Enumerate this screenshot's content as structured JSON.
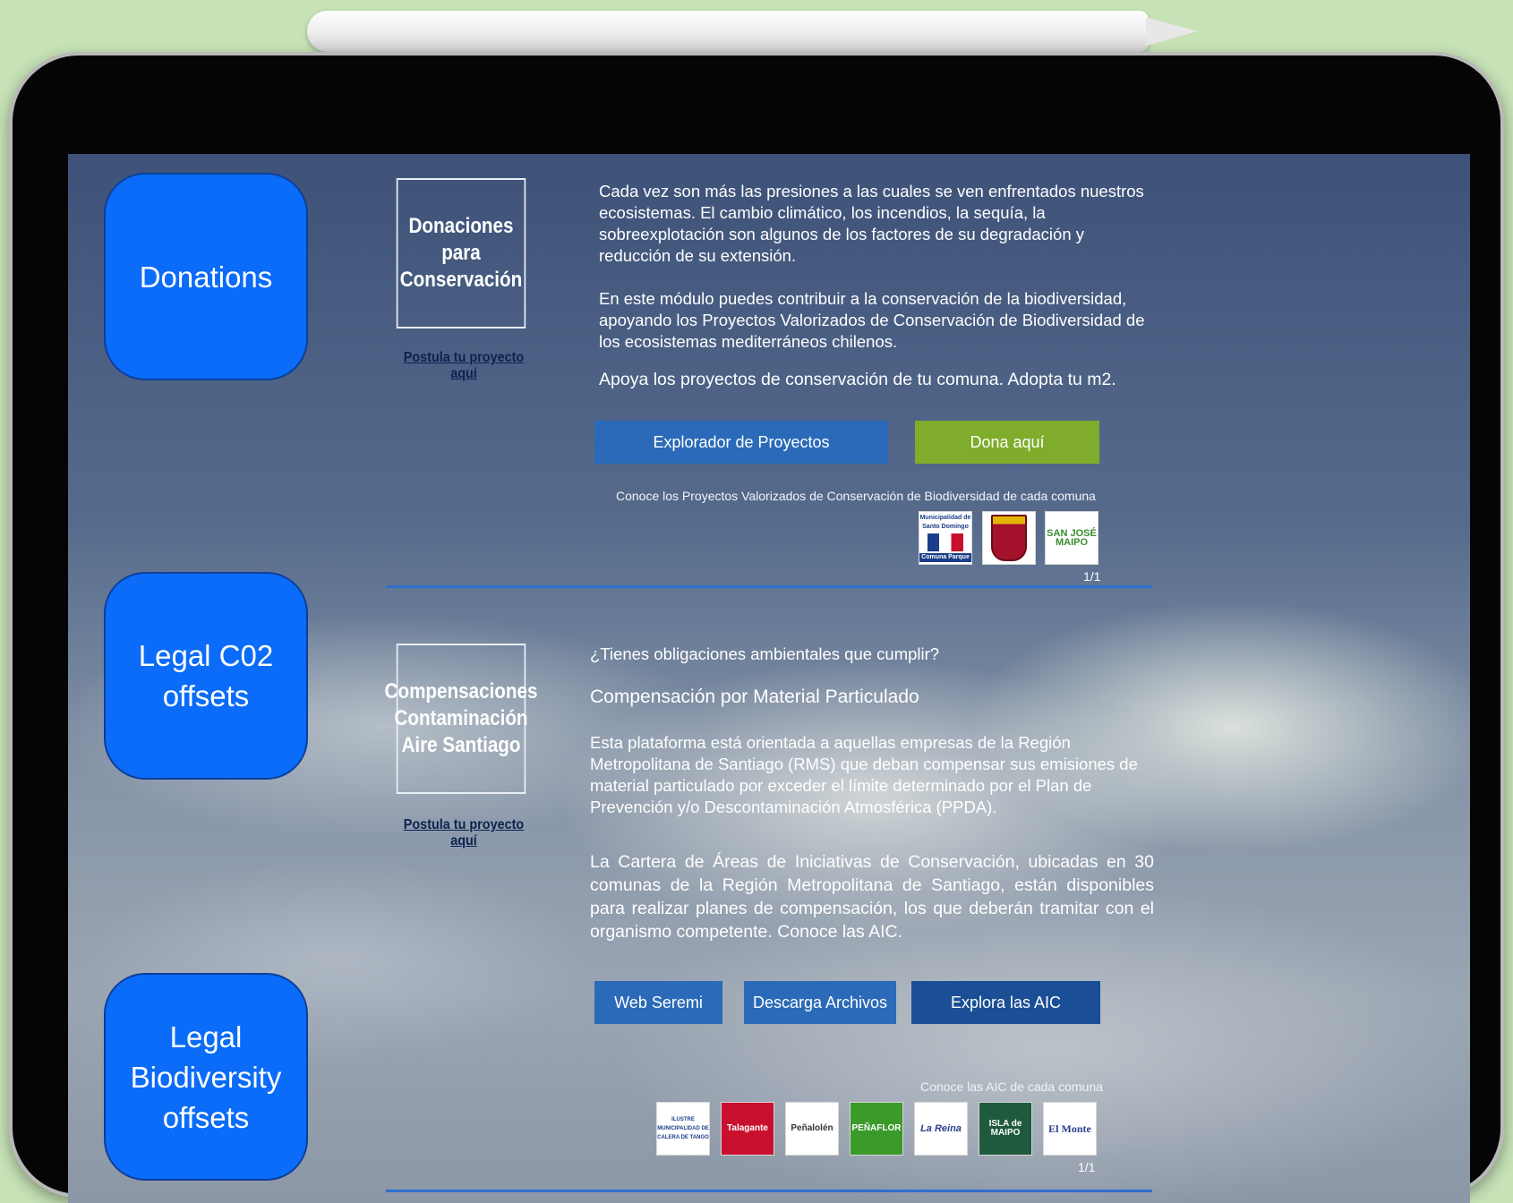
{
  "nav": {
    "donations": "Donations",
    "legal_co2": "Legal C02 offsets",
    "legal_biodiversity": "Legal Biodiversity offsets"
  },
  "section1": {
    "logo_text": "Donaciones para Conservación",
    "postula_link": "Postula tu proyecto aquí",
    "paragraph1": "Cada vez son más las presiones a las cuales se ven enfrentados nuestros ecosistemas. El cambio climático, los incendios, la sequía, la sobreexplotación son algunos de los factores de su degradación y reducción de su extensión.",
    "paragraph2": "En este módulo puedes contribuir a la conservación de la biodiversidad, apoyando los Proyectos Valorizados de Conservación de Biodiversidad de los ecosistemas mediterráneos chilenos.",
    "paragraph3": "Apoya los proyectos de conservación de tu comuna. Adopta tu m2.",
    "button_explorer": "Explorador de Proyectos",
    "button_donate": "Dona aquí",
    "caption": "Conoce los Proyectos Valorizados de Conservación de Biodiversidad de cada comuna",
    "logos": [
      {
        "top": "Municipalidad de Santo Domingo",
        "bottom": "Comuna Parque"
      },
      {
        "text": ""
      },
      {
        "text": "SAN JOSÉ MAIPO"
      }
    ],
    "pager": "1/1"
  },
  "section2": {
    "logo_text": "Compensaciones Contaminación Aire Santiago",
    "postula_link": "Postula tu proyecto aquí",
    "question": "¿Tienes obligaciones ambientales que cumplir?",
    "heading": "Compensación por Material Particulado",
    "paragraph1": "Esta plataforma está orientada a aquellas empresas de la Región Metropolitana de Santiago (RMS) que deban compensar sus emisiones de material particulado por exceder el límite determinado por el Plan de Prevención y/o Descontaminación Atmosférica (PPDA).",
    "paragraph2": "La Cartera de Áreas de Iniciativas de Conservación, ubicadas en 30 comunas de la Región Metropolitana de Santiago, están disponibles para realizar planes de compensación, los que deberán tramitar con el organismo competente. Conoce las AIC.",
    "button_web": "Web Seremi",
    "button_download": "Descarga Archivos",
    "button_explore": "Explora las AIC",
    "caption": "Conoce las AIC de cada comuna",
    "logos": [
      {
        "text": "ILUSTRE MUNICIPALIDAD DE CALERA DE TANGO"
      },
      {
        "text": "Talagante"
      },
      {
        "text": "Peñalolén"
      },
      {
        "text": "PEÑAFLOR"
      },
      {
        "text": "La Reina"
      },
      {
        "text": "ISLA de MAIPO"
      },
      {
        "text": "El Monte"
      }
    ],
    "pager": "1/1"
  },
  "colors": {
    "nav_blue": "#0a6cf8",
    "button_blue": "#2a6ab8",
    "button_dark_blue": "#1a4f96",
    "donate_green": "#7fad2b",
    "rule_blue": "#2f6fd0"
  }
}
